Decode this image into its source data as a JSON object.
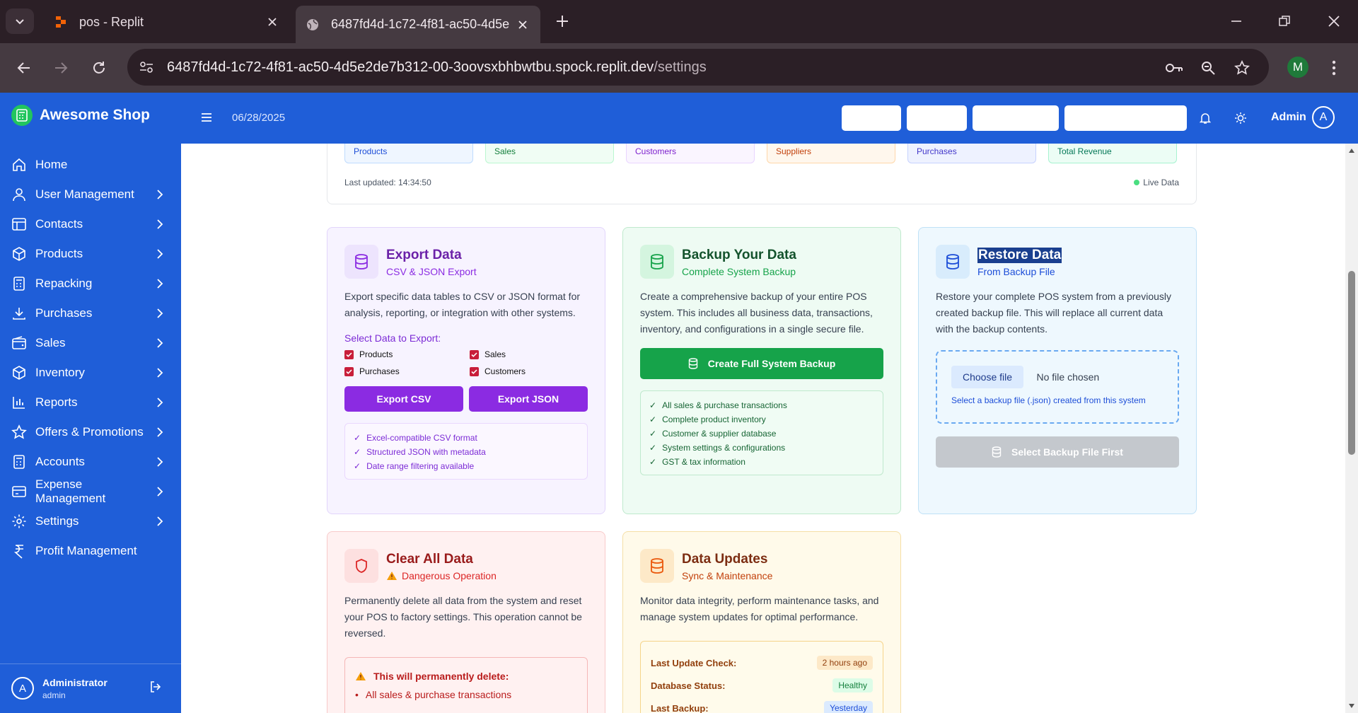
{
  "browser": {
    "tabs": [
      {
        "title": "pos - Replit"
      },
      {
        "title": "6487fd4d-1c72-4f81-ac50-4d5e"
      }
    ],
    "url_host": "6487fd4d-1c72-4f81-ac50-4d5e2de7b312-00-3oovsxbhbwtbu.spock.replit.dev",
    "url_path": "/settings",
    "profile_initial": "M"
  },
  "header": {
    "brand": "Awesome Shop",
    "date": "06/28/2025",
    "user": "Admin",
    "avatar_initial": "A"
  },
  "sidebar": {
    "items": [
      {
        "label": "Home",
        "icon": "home-icon",
        "chevron": false
      },
      {
        "label": "User Management",
        "icon": "user-icon",
        "chevron": true
      },
      {
        "label": "Contacts",
        "icon": "contacts-icon",
        "chevron": true
      },
      {
        "label": "Products",
        "icon": "box-icon",
        "chevron": true
      },
      {
        "label": "Repacking",
        "icon": "calculator-icon",
        "chevron": true
      },
      {
        "label": "Purchases",
        "icon": "download-icon",
        "chevron": true
      },
      {
        "label": "Sales",
        "icon": "wallet-icon",
        "chevron": true
      },
      {
        "label": "Inventory",
        "icon": "box-icon",
        "chevron": true
      },
      {
        "label": "Reports",
        "icon": "bar-chart-icon",
        "chevron": true
      },
      {
        "label": "Offers & Promotions",
        "icon": "star-icon",
        "chevron": true
      },
      {
        "label": "Accounts",
        "icon": "calculator-icon",
        "chevron": true
      },
      {
        "label": "Expense Management",
        "icon": "card-icon",
        "chevron": true
      },
      {
        "label": "Settings",
        "icon": "gear-icon",
        "chevron": true
      },
      {
        "label": "Profit Management",
        "icon": "rupee-icon",
        "chevron": false
      }
    ],
    "footer": {
      "name": "Administrator",
      "role": "admin",
      "initial": "A"
    }
  },
  "stats": {
    "chips": [
      "Products",
      "Sales",
      "Customers",
      "Suppliers",
      "Purchases",
      "Total Revenue"
    ],
    "last_updated": "Last updated: 14:34:50",
    "live": "Live Data"
  },
  "export": {
    "title": "Export Data",
    "subtitle": "CSV & JSON Export",
    "desc": "Export specific data tables to CSV or JSON format for analysis, reporting, or integration with other systems.",
    "select_title": "Select Data to Export:",
    "options": [
      "Products",
      "Sales",
      "Purchases",
      "Customers"
    ],
    "btn_csv": "Export CSV",
    "btn_json": "Export JSON",
    "features": [
      "Excel-compatible CSV format",
      "Structured JSON with metadata",
      "Date range filtering available"
    ]
  },
  "backup": {
    "title": "Backup Your Data",
    "subtitle": "Complete System Backup",
    "desc": "Create a comprehensive backup of your entire POS system. This includes all business data, transactions, inventory, and configurations in a single secure file.",
    "button": "Create Full System Backup",
    "features": [
      "All sales & purchase transactions",
      "Complete product inventory",
      "Customer & supplier database",
      "System settings & configurations",
      "GST & tax information"
    ]
  },
  "restore": {
    "title": "Restore Data",
    "subtitle": "From Backup File",
    "desc": "Restore your complete POS system from a previously created backup file. This will replace all current data with the backup contents.",
    "choose_file": "Choose file",
    "no_file": "No file chosen",
    "hint": "Select a backup file (.json) created from this system",
    "button": "Select Backup File First"
  },
  "clear": {
    "title": "Clear All Data",
    "subtitle": "Dangerous Operation",
    "desc": "Permanently delete all data from the system and reset your POS to factory settings. This operation cannot be reversed.",
    "warn_title": "This will permanently delete:",
    "items": [
      "All sales & purchase transactions"
    ]
  },
  "updates": {
    "title": "Data Updates",
    "subtitle": "Sync & Maintenance",
    "desc": "Monitor data integrity, perform maintenance tasks, and manage system updates for optimal performance.",
    "rows": [
      {
        "label": "Last Update Check:",
        "value": "2 hours ago"
      },
      {
        "label": "Database Status:",
        "value": "Healthy"
      },
      {
        "label": "Last Backup:",
        "value": "Yesterday"
      }
    ]
  },
  "colors": {
    "brand_blue": "#1f5ed8",
    "purple": "#8b2be2",
    "green": "#16a34a",
    "red": "#b91c1c",
    "amber": "#c2410c"
  }
}
